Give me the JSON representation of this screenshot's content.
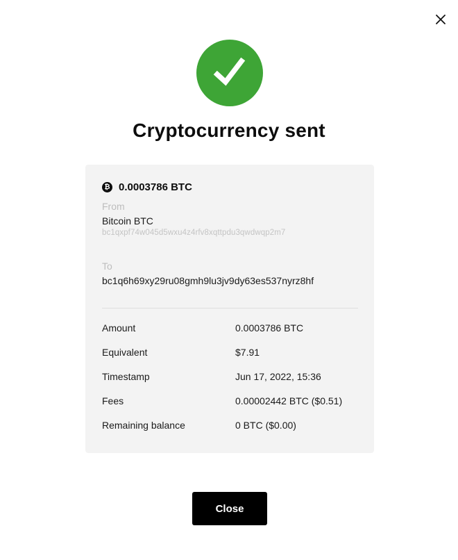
{
  "dialog": {
    "title": "Cryptocurrency sent",
    "close_icon": "close-icon",
    "success_icon": "checkmark-icon",
    "success_color": "#3ea536"
  },
  "transaction": {
    "currency_icon": "bitcoin-icon",
    "currency_symbol_glyph": "₿",
    "amount": "0.0003786 BTC",
    "from_label": "From",
    "from_wallet": "Bitcoin BTC",
    "from_address": "bc1qxpf74w045d5wxu4z4rfv8xqttpdu3qwdwqp2m7",
    "to_label": "To",
    "to_address": "bc1q6h69xy29ru08gmh9lu3jv9dy63es537nyrz8hf"
  },
  "details": [
    {
      "label": "Amount",
      "value": "0.0003786 BTC"
    },
    {
      "label": "Equivalent",
      "value": "$7.91"
    },
    {
      "label": "Timestamp",
      "value": "Jun 17, 2022, 15:36"
    },
    {
      "label": "Fees",
      "value": "0.00002442 BTC ($0.51)"
    },
    {
      "label": "Remaining balance",
      "value": "0 BTC ($0.00)"
    }
  ],
  "actions": {
    "close_label": "Close"
  }
}
